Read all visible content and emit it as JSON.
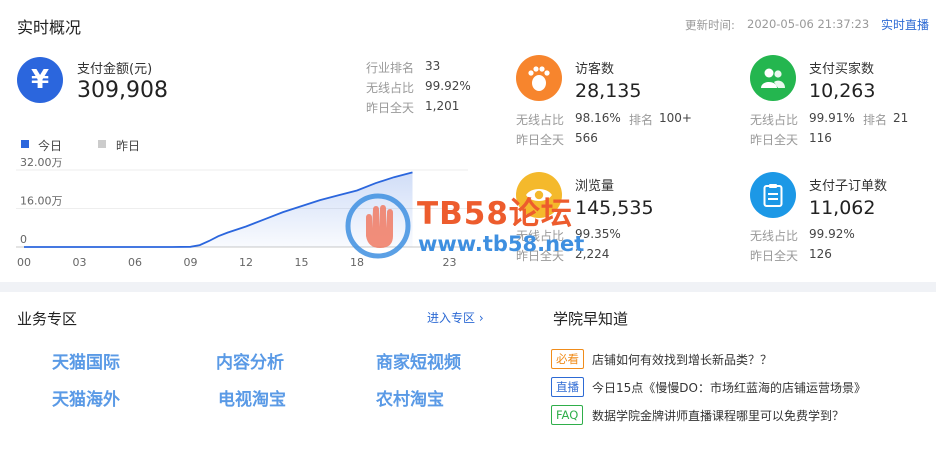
{
  "header": {
    "title": "实时概况",
    "update_label": "更新时间:",
    "update_time": "2020-05-06 21:37:23",
    "live_link": "实时直播"
  },
  "payment": {
    "icon": "yen-icon",
    "icon_glyph": "¥",
    "label": "支付金额(元)",
    "value": "309,908",
    "rank_label": "行业排名",
    "rank_value": "33",
    "wireless_label": "无线占比",
    "wireless_value": "99.92%",
    "yesterday_label": "昨日全天",
    "yesterday_value": "1,201"
  },
  "legend": {
    "today": "今日",
    "yesterday": "昨日",
    "today_color": "#2b66dd",
    "yesterday_color": "#cccccc"
  },
  "metrics": {
    "visitors": {
      "label": "访客数",
      "value": "28,135",
      "wireless_label": "无线占比",
      "wireless_value": "98.16%",
      "rank_label": "排名",
      "rank_value": "100+",
      "yesterday_label": "昨日全天",
      "yesterday_value": "566"
    },
    "buyers": {
      "label": "支付买家数",
      "value": "10,263",
      "wireless_label": "无线占比",
      "wireless_value": "99.91%",
      "rank_label": "排名",
      "rank_value": "21",
      "yesterday_label": "昨日全天",
      "yesterday_value": "116"
    },
    "pageviews": {
      "label": "浏览量",
      "value": "145,535",
      "wireless_label": "无线占比",
      "wireless_value": "99.35%",
      "yesterday_label": "昨日全天",
      "yesterday_value": "2,224"
    },
    "orders": {
      "label": "支付子订单数",
      "value": "11,062",
      "wireless_label": "无线占比",
      "wireless_value": "99.92%",
      "yesterday_label": "昨日全天",
      "yesterday_value": "126"
    }
  },
  "chart_data": {
    "type": "area",
    "y_ticks": [
      "32.00万",
      "16.00万",
      "0"
    ],
    "y_tick_values": [
      320000,
      160000,
      0
    ],
    "ylim": [
      0,
      320000
    ],
    "xlim": [
      0,
      24
    ],
    "x_ticks": [
      "00",
      "03",
      "06",
      "09",
      "12",
      "15",
      "18",
      "23"
    ],
    "x_tick_values": [
      0,
      3,
      6,
      9,
      12,
      15,
      18,
      23
    ],
    "series": [
      {
        "name": "今日",
        "color": "#2b66dd",
        "x": [
          0,
          1,
          2,
          3,
          4,
          5,
          6,
          7,
          8,
          9,
          9.5,
          10,
          10.5,
          11,
          12,
          13,
          14,
          15,
          16,
          17,
          18,
          19,
          20,
          21
        ],
        "y": [
          0,
          0,
          0,
          0,
          0,
          0,
          0,
          0,
          0,
          1000,
          8000,
          25000,
          45000,
          60000,
          85000,
          115000,
          145000,
          170000,
          195000,
          215000,
          235000,
          265000,
          290000,
          309908
        ]
      }
    ]
  },
  "biz_zone": {
    "title": "业务专区",
    "enter_link": "进入专区 ›",
    "links": [
      "天猫国际",
      "内容分析",
      "商家短视频",
      "天猫海外",
      "电视淘宝",
      "农村淘宝"
    ]
  },
  "academy": {
    "title": "学院早知道",
    "items": [
      {
        "tag": "必看",
        "text": "店铺如何有效找到增长新品类？？"
      },
      {
        "tag": "直播",
        "text": "今日15点《慢慢DO：市场红蓝海的店铺运营场景》"
      },
      {
        "tag": "FAQ",
        "text": "数据学院金牌讲师直播课程哪里可以免费学到？"
      }
    ]
  },
  "watermark": {
    "brand": "TB58论坛",
    "url": "www.tb58.net"
  }
}
